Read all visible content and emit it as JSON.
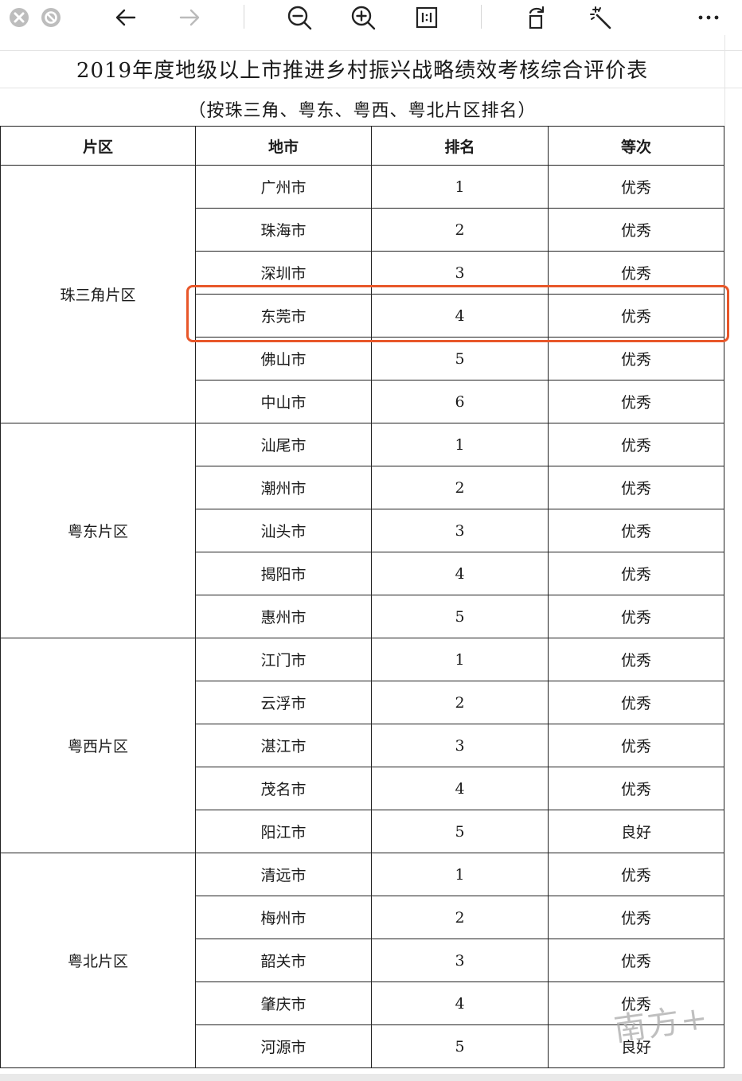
{
  "toolbar": {
    "icons": [
      "close-icon",
      "block-icon",
      "back-arrow-icon",
      "forward-arrow-icon",
      "zoom-out-icon",
      "zoom-in-icon",
      "actual-size-icon",
      "rotate-icon",
      "magic-wand-icon",
      "more-icon"
    ]
  },
  "document": {
    "title": "2019年度地级以上市推进乡村振兴战略绩效考核综合评价表",
    "subtitle": "（按珠三角、粤东、粤西、粤北片区排名）",
    "headers": [
      "片区",
      "地市",
      "排名",
      "等次"
    ],
    "regions": [
      {
        "name": "珠三角片区",
        "rows": [
          {
            "city": "广州市",
            "rank": "1",
            "grade": "优秀"
          },
          {
            "city": "珠海市",
            "rank": "2",
            "grade": "优秀"
          },
          {
            "city": "深圳市",
            "rank": "3",
            "grade": "优秀"
          },
          {
            "city": "东莞市",
            "rank": "4",
            "grade": "优秀"
          },
          {
            "city": "佛山市",
            "rank": "5",
            "grade": "优秀"
          },
          {
            "city": "中山市",
            "rank": "6",
            "grade": "优秀"
          }
        ]
      },
      {
        "name": "粤东片区",
        "rows": [
          {
            "city": "汕尾市",
            "rank": "1",
            "grade": "优秀"
          },
          {
            "city": "潮州市",
            "rank": "2",
            "grade": "优秀"
          },
          {
            "city": "汕头市",
            "rank": "3",
            "grade": "优秀"
          },
          {
            "city": "揭阳市",
            "rank": "4",
            "grade": "优秀"
          },
          {
            "city": "惠州市",
            "rank": "5",
            "grade": "优秀"
          }
        ]
      },
      {
        "name": "粤西片区",
        "rows": [
          {
            "city": "江门市",
            "rank": "1",
            "grade": "优秀"
          },
          {
            "city": "云浮市",
            "rank": "2",
            "grade": "优秀"
          },
          {
            "city": "湛江市",
            "rank": "3",
            "grade": "优秀"
          },
          {
            "city": "茂名市",
            "rank": "4",
            "grade": "优秀"
          },
          {
            "city": "阳江市",
            "rank": "5",
            "grade": "良好"
          }
        ]
      },
      {
        "name": "粤北片区",
        "rows": [
          {
            "city": "清远市",
            "rank": "1",
            "grade": "优秀"
          },
          {
            "city": "梅州市",
            "rank": "2",
            "grade": "优秀"
          },
          {
            "city": "韶关市",
            "rank": "3",
            "grade": "优秀"
          },
          {
            "city": "肇庆市",
            "rank": "4",
            "grade": "优秀"
          },
          {
            "city": "河源市",
            "rank": "5",
            "grade": "良好"
          }
        ]
      }
    ],
    "highlighted_city": "东莞市"
  },
  "watermark": "南方+",
  "colors": {
    "highlight": "#e8572a",
    "icon": "#222222",
    "icon_disabled": "#bbbbbb",
    "close_badge": "#bdbdbd"
  }
}
